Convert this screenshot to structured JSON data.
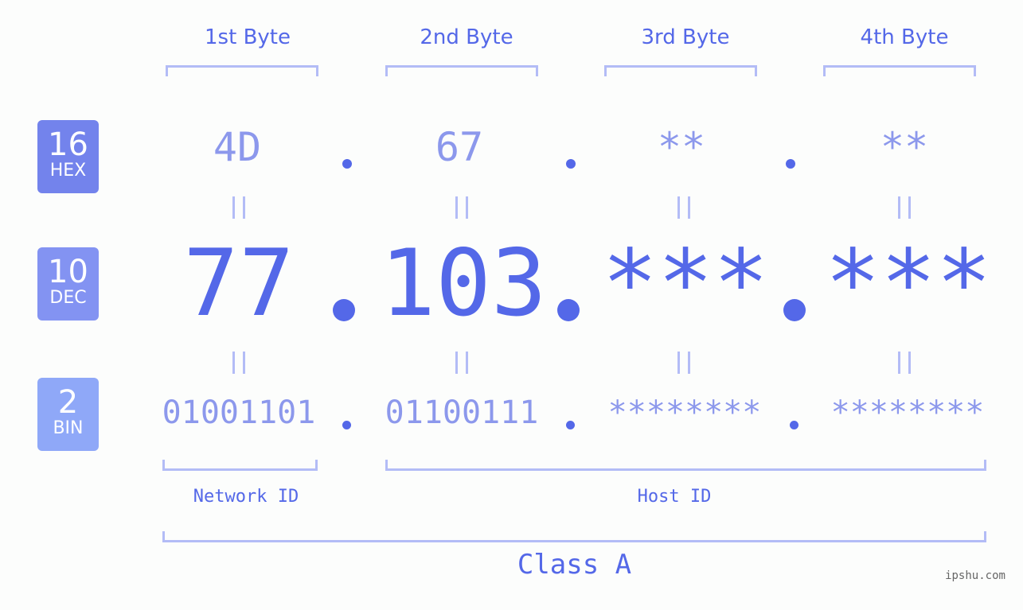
{
  "byte_headers": [
    "1st Byte",
    "2nd Byte",
    "3rd Byte",
    "4th Byte"
  ],
  "badges": {
    "hex": {
      "number": "16",
      "label": "HEX",
      "color": "#7383ec"
    },
    "dec": {
      "number": "10",
      "label": "DEC",
      "color": "#8393f2"
    },
    "bin": {
      "number": "2",
      "label": "BIN",
      "color": "#8fa8f8"
    }
  },
  "hex_values": [
    "4D",
    "67",
    "**",
    "**"
  ],
  "dec_values": [
    "77",
    "103",
    "***",
    "***"
  ],
  "bin_values": [
    "01001101",
    "01100111",
    "********",
    "********"
  ],
  "network_id_label": "Network ID",
  "host_id_label": "Host ID",
  "class_label": "Class A",
  "watermark": "ipshu.com",
  "colors": {
    "accent": "#5468e8",
    "secondary": "#8c98ec",
    "bracket": "#b3bcf6",
    "background": "#fcfdfc"
  }
}
